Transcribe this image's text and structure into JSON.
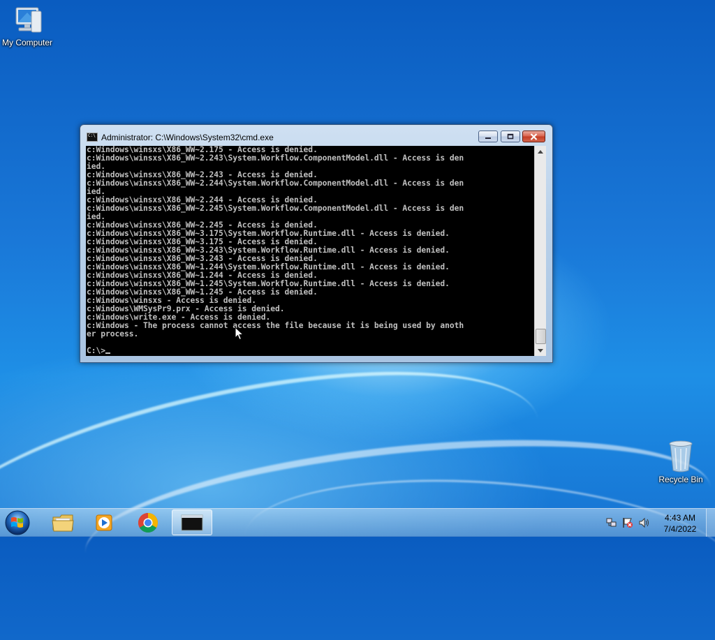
{
  "desktop": {
    "icons": [
      {
        "label": "My Computer"
      },
      {
        "label": "Recycle Bin"
      }
    ]
  },
  "cmd": {
    "title": "Administrator: C:\\Windows\\System32\\cmd.exe",
    "icon_text": "C:\\",
    "lines": [
      "c:Windows\\winsxs\\X86_WW~2.175 - Access is denied.",
      "c:Windows\\winsxs\\X86_WW~2.243\\System.Workflow.ComponentModel.dll - Access is den",
      "ied.",
      "c:Windows\\winsxs\\X86_WW~2.243 - Access is denied.",
      "c:Windows\\winsxs\\X86_WW~2.244\\System.Workflow.ComponentModel.dll - Access is den",
      "ied.",
      "c:Windows\\winsxs\\X86_WW~2.244 - Access is denied.",
      "c:Windows\\winsxs\\X86_WW~2.245\\System.Workflow.ComponentModel.dll - Access is den",
      "ied.",
      "c:Windows\\winsxs\\X86_WW~2.245 - Access is denied.",
      "c:Windows\\winsxs\\X86_WW~3.175\\System.Workflow.Runtime.dll - Access is denied.",
      "c:Windows\\winsxs\\X86_WW~3.175 - Access is denied.",
      "c:Windows\\winsxs\\X86_WW~3.243\\System.Workflow.Runtime.dll - Access is denied.",
      "c:Windows\\winsxs\\X86_WW~3.243 - Access is denied.",
      "c:Windows\\winsxs\\X86_WW~1.244\\System.Workflow.Runtime.dll - Access is denied.",
      "c:Windows\\winsxs\\X86_WW~1.244 - Access is denied.",
      "c:Windows\\winsxs\\X86_WW~1.245\\System.Workflow.Runtime.dll - Access is denied.",
      "c:Windows\\winsxs\\X86_WW~1.245 - Access is denied.",
      "c:Windows\\winsxs - Access is denied.",
      "c:Windows\\WMSysPr9.prx - Access is denied.",
      "c:Windows\\write.exe - Access is denied.",
      "c:Windows - The process cannot access the file because it is being used by anoth",
      "er process."
    ],
    "prompt": "C:\\>"
  },
  "taskbar": {
    "clock_time": "4:43 AM",
    "clock_date": "7/4/2022",
    "cmd_icon_text": "C:\\_"
  },
  "colors": {
    "console_bg": "#000000",
    "console_fg": "#c0c0c0",
    "close_button": "#c43b22"
  }
}
